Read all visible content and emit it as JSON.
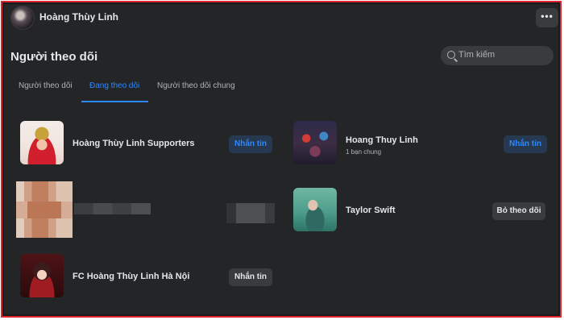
{
  "header": {
    "profile_name": "Hoàng Thùy Linh",
    "more_label": "•••"
  },
  "page": {
    "title": "Người theo dõi"
  },
  "search": {
    "placeholder": "Tìm kiếm"
  },
  "tabs": [
    {
      "label": "Người theo dõi",
      "active": false
    },
    {
      "label": "Đang theo dõi",
      "active": true
    },
    {
      "label": "Người theo dõi chung",
      "active": false
    }
  ],
  "following": [
    {
      "name": "Hoàng Thùy Linh Supporters",
      "subtitle": "",
      "button": "Nhắn tin",
      "button_style": "blue"
    },
    {
      "name": "Hoang Thuy Linh",
      "subtitle": "1 bạn chung",
      "button": "Nhắn tin",
      "button_style": "blue"
    },
    {
      "name": "Taylor Swift",
      "subtitle": "",
      "button": "Bỏ theo dõi",
      "button_style": "gray"
    },
    {
      "name": "FC Hoàng Thùy Linh Hà Nội",
      "subtitle": "",
      "button": "Nhắn tin",
      "button_style": "gray"
    }
  ],
  "colors": {
    "accent": "#2d88ff",
    "panel": "#242526",
    "frame_border": "#e0242c"
  }
}
